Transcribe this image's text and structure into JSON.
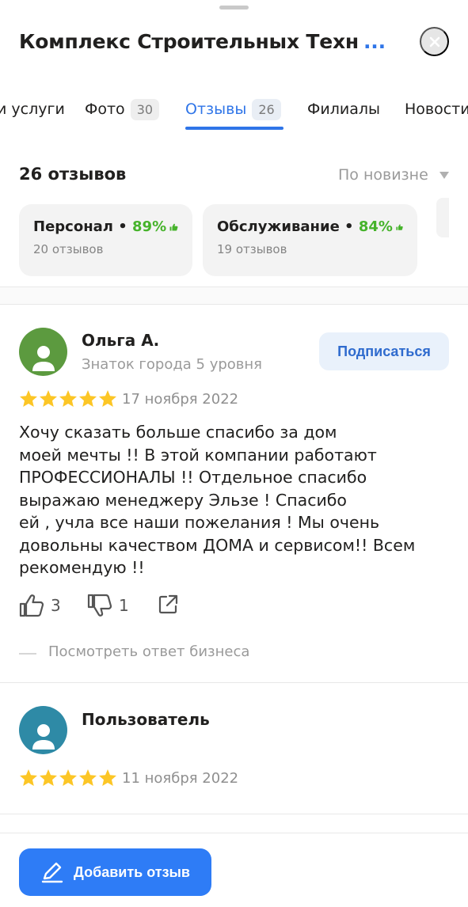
{
  "header": {
    "title": "Комплекс Строительных Техн",
    "more": "...",
    "close_icon": "close-icon"
  },
  "tabs": [
    {
      "label": "и услуги"
    },
    {
      "label": "Фото",
      "count": "30"
    },
    {
      "label": "Отзывы",
      "count": "26",
      "active": true
    },
    {
      "label": "Филиалы"
    },
    {
      "label": "Новости"
    }
  ],
  "reviews_summary": {
    "count_text": "26 отзывов",
    "sort_label": "По новизне"
  },
  "aspects": [
    {
      "name": "Персонал",
      "separator": " • ",
      "percent": "89%",
      "reviews": "20 отзывов"
    },
    {
      "name": "Обслуживание",
      "separator": " • ",
      "percent": "84%",
      "reviews": "19 отзывов"
    }
  ],
  "reviews": [
    {
      "author": "Ольга А.",
      "level": "Знаток города 5 уровня",
      "subscribe_label": "Подписаться",
      "rating": 5,
      "date": "17 ноября 2022",
      "text": "Хочу сказать больше спасибо за дом\nмоей мечты !! В этой компании работают\nПРОФЕССИОНАЛЫ !! Отдельное спасибо\nвыражаю менеджеру Эльзе ! Спасибо\nей , учла все наши пожелания ! Мы очень\nдовольны качеством ДОМА и сервисом!! Всем\nрекомендую !!",
      "likes": "3",
      "dislikes": "1",
      "business_reply_label": "Посмотреть ответ бизнеса",
      "avatar_color": "#5c9a3f"
    },
    {
      "author": "Пользователь",
      "rating": 5,
      "date": "11 ноября 2022",
      "avatar_color": "#2e8aa6"
    }
  ],
  "footer": {
    "add_review_label": "Добавить отзыв"
  },
  "colors": {
    "accent": "#2f75e8",
    "star": "#fcc626",
    "positive": "#46b32b",
    "button": "#2e7cf6"
  }
}
